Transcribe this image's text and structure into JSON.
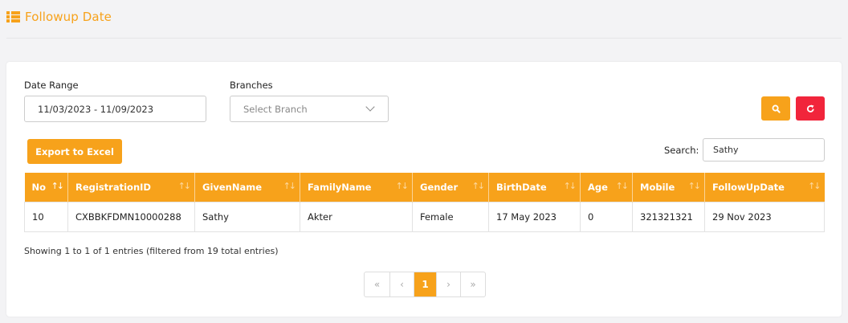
{
  "header": {
    "title": "Followup Date",
    "icon": "list-icon"
  },
  "filters": {
    "date_range_label": "Date Range",
    "date_range_value": "11/03/2023 - 11/09/2023",
    "branches_label": "Branches",
    "branch_placeholder": "Select Branch",
    "search_button_icon": "search-icon",
    "reset_button_icon": "refresh-icon"
  },
  "toolbar": {
    "export_label": "Export to Excel",
    "search_label": "Search:",
    "search_value": "Sathy"
  },
  "table": {
    "columns": [
      "No",
      "RegistrationID",
      "GivenName",
      "FamilyName",
      "Gender",
      "BirthDate",
      "Age",
      "Mobile",
      "FollowUpDate"
    ],
    "rows": [
      [
        "10",
        "CXBBKFDMN10000288",
        "Sathy",
        "Akter",
        "Female",
        "17 May 2023",
        "0",
        "321321321",
        "29 Nov 2023"
      ]
    ]
  },
  "info": "Showing 1 to 1 of 1 entries (filtered from 19 total entries)",
  "pagination": {
    "first": "«",
    "prev": "‹",
    "current": "1",
    "next": "›",
    "last": "»"
  },
  "colors": {
    "accent": "#f7a21b",
    "danger": "#f1253b"
  }
}
